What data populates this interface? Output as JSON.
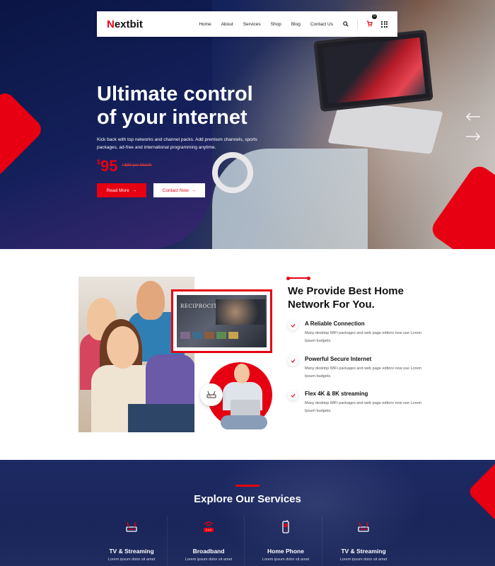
{
  "brand": {
    "logo_initial": "N",
    "logo_rest": "extbit",
    "accent": "#e60012",
    "navy": "#1a255a"
  },
  "nav": {
    "items": [
      "Home",
      "About",
      "Services",
      "Shop",
      "Blog",
      "Contact Us"
    ],
    "cart_count": "0"
  },
  "hero": {
    "title_line1": "Ultimate control",
    "title_line2": "of your internet",
    "description": "Kick back with top networks and channel packs. Add premium channels, sports packages, ad-free and international programming anytime.",
    "price_currency": "$",
    "price_value": "95",
    "price_old": "/ $99 per Month",
    "read_more": "Read More",
    "contact_now": "Contact Now",
    "arrow_glyph": "→"
  },
  "about": {
    "title": "We Provide Best Home Network For You.",
    "tv_title": "RECIPROCITY",
    "features": [
      {
        "title": "A Reliable Connection",
        "text": "Many desktop WiFi packages and web page editors now use Lorem Ipsum budgets."
      },
      {
        "title": "Powerful Secure Internet",
        "text": "Many desktop WiFi packages and web page editors now use Lorem Ipsum budgets."
      },
      {
        "title": "Flex 4K & 8K streaming",
        "text": "Many desktop WiFi packages and web page editors now use Lorem Ipsum budgets."
      }
    ]
  },
  "services": {
    "title": "Explore Our Services",
    "cards": [
      {
        "name": "TV & Streaming",
        "sub": "Lorem ipsum dolor sit amet",
        "icon": "router-icon"
      },
      {
        "name": "Broadband",
        "sub": "Lorem ipsum dolor sit amet",
        "icon": "wifi-router-icon"
      },
      {
        "name": "Home Phone",
        "sub": "Lorem ipsum dolor sit amet",
        "icon": "phone-icon"
      },
      {
        "name": "TV & Streaming",
        "sub": "Lorem ipsum dolor sit amet",
        "icon": "router-icon"
      }
    ]
  }
}
